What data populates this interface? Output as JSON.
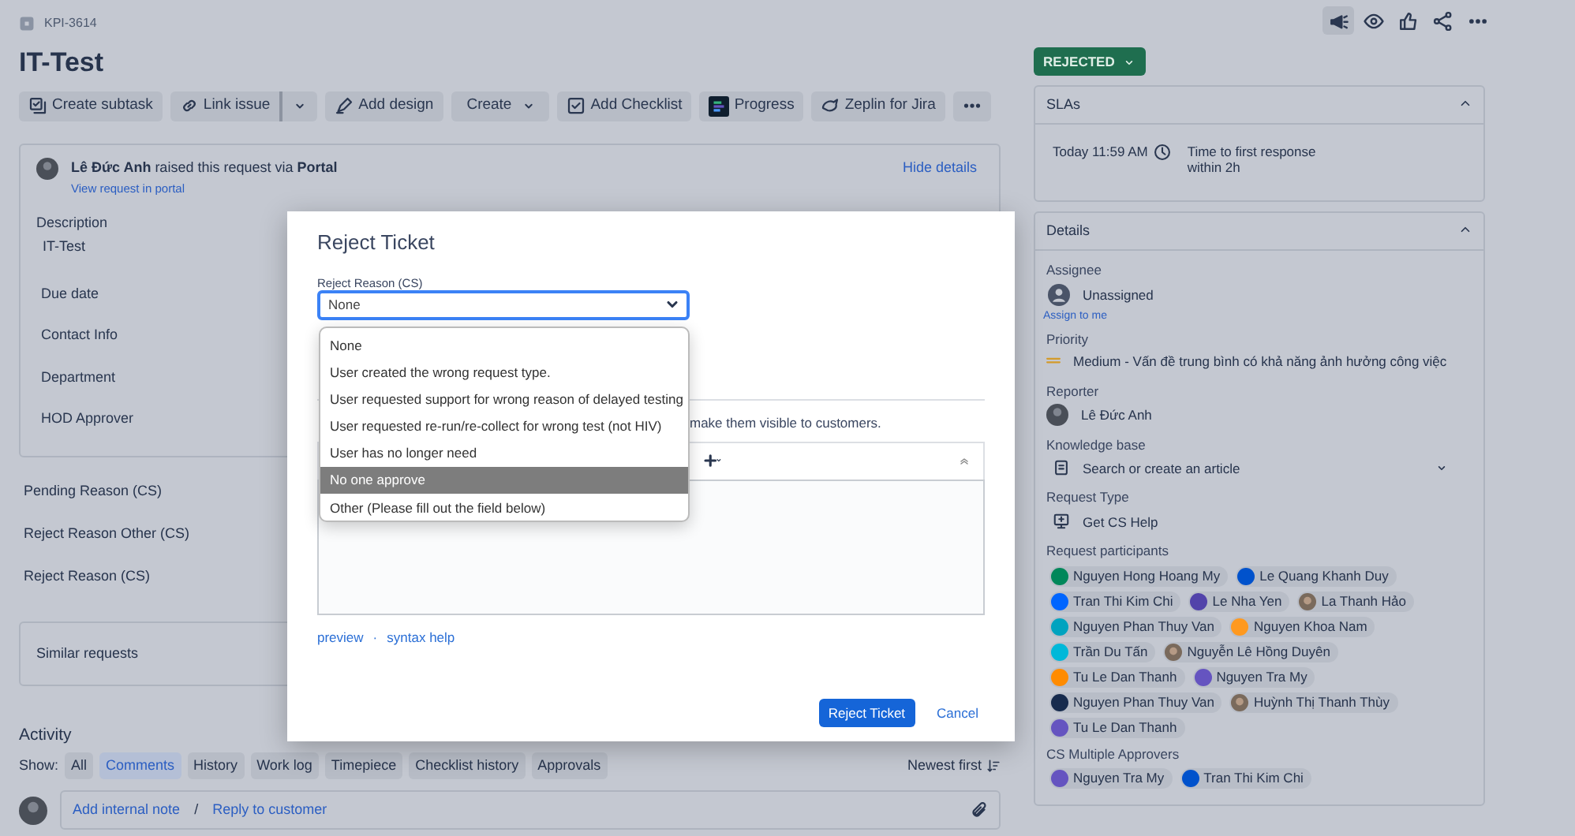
{
  "issue_key": "KPI-3614",
  "title": "IT-Test",
  "toolbar": [
    {
      "label": "Create subtask",
      "kind": "subtask"
    },
    {
      "label": "Link issue",
      "kind": "link"
    },
    {
      "label": "Add design",
      "kind": "design"
    },
    {
      "label": "Create",
      "kind": "menu"
    },
    {
      "label": "Add Checklist",
      "kind": "checklist"
    },
    {
      "label": "Progress",
      "kind": "progress"
    },
    {
      "label": "Zeplin for Jira",
      "kind": "zeplin"
    },
    {
      "kind": "more"
    }
  ],
  "request": {
    "sentence": "**Lê Đức Anh** raised this request via **Portal**",
    "view_link": "View request in portal",
    "hide_link": "Hide details",
    "fields": [
      {
        "label": "Description",
        "value": "IT-Test"
      },
      {
        "label": "Due date"
      },
      {
        "label": "Contact Info"
      },
      {
        "label": "Department"
      },
      {
        "label": "HOD Approver"
      }
    ]
  },
  "extra_fields": [
    "Pending Reason (CS)",
    "Reject Reason Other (CS)",
    "Reject Reason (CS)"
  ],
  "similar": "Similar requests",
  "activity": {
    "title": "Activity",
    "show_label": "Show:",
    "filters": [
      {
        "label": "All",
        "selected": false
      },
      {
        "label": "Comments",
        "selected": true
      },
      {
        "label": "History",
        "selected": false
      },
      {
        "label": "Work log",
        "selected": false
      },
      {
        "label": "Timepiece",
        "selected": false
      },
      {
        "label": "Checklist history",
        "selected": false
      },
      {
        "label": "Approvals",
        "selected": false
      }
    ],
    "sort": "Newest first",
    "internal_note": "Add internal note",
    "separator": "/",
    "reply": "Reply to customer"
  },
  "header_icons": [
    {
      "kind": "megaphone",
      "selected": true
    },
    {
      "kind": "eye",
      "selected": false
    },
    {
      "kind": "like",
      "selected": false
    },
    {
      "kind": "share",
      "selected": false
    },
    {
      "kind": "more",
      "selected": false
    }
  ],
  "status": "REJECTED",
  "slas": {
    "title": "SLAs",
    "time": "Today 11:59 AM",
    "goal": "Time to first response",
    "target": "within 2h"
  },
  "details": {
    "title": "Details",
    "assignee": {
      "label": "Assignee",
      "value": "Unassigned",
      "link": "Assign to me"
    },
    "priority": {
      "label": "Priority",
      "value": "Medium - Vấn đề trung bình có khả năng ảnh hưởng công việc"
    },
    "reporter": {
      "label": "Reporter",
      "value": "Lê Đức Anh"
    },
    "knowledge_base": {
      "label": "Knowledge base",
      "placeholder": "Search or create an article"
    },
    "request_type": {
      "label": "Request Type",
      "value": "Get CS Help"
    },
    "participants": {
      "label": "Request participants",
      "list": [
        {
          "name": "Nguyen Hong Hoang My",
          "kind": "initials",
          "color": "#00875a"
        },
        {
          "name": "Le Quang Khanh Duy",
          "kind": "initials",
          "color": "#0052cc"
        },
        {
          "name": "Tran Thi Kim Chi",
          "kind": "initials",
          "color": "#0065ff"
        },
        {
          "name": "Le Nha Yen",
          "kind": "initials",
          "color": "#5243aa"
        },
        {
          "name": "La Thanh Hảo",
          "kind": "photo"
        },
        {
          "name": "Nguyen Phan Thuy Van",
          "kind": "initials",
          "color": "#00a3bf"
        },
        {
          "name": "Nguyen Khoa Nam",
          "kind": "initials",
          "color": "#ff991f"
        },
        {
          "name": "Trần Du Tấn",
          "kind": "initials",
          "color": "#00b8d9"
        },
        {
          "name": "Nguyễn Lê Hồng Duyên",
          "kind": "photo"
        },
        {
          "name": "Tu Le Dan Thanh",
          "kind": "initials",
          "color": "#ff8b00"
        },
        {
          "name": "Nguyen Tra My",
          "kind": "initials",
          "color": "#6554c0"
        },
        {
          "name": "Nguyen Phan Thuy Van",
          "kind": "initials",
          "color": "#172b4d"
        },
        {
          "name": "Huỳnh Thị Thanh Thùy",
          "kind": "photo"
        },
        {
          "name": "Tu Le Dan Thanh",
          "kind": "initials",
          "color": "#6554c0"
        }
      ]
    },
    "approvers": {
      "label": "CS Multiple Approvers",
      "list": [
        {
          "name": "Nguyen Tra My",
          "kind": "initials",
          "color": "#6554c0"
        },
        {
          "name": "Tran Thi Kim Chi",
          "kind": "initials",
          "color": "#0052cc"
        }
      ]
    }
  },
  "modal": {
    "title": "Reject Ticket",
    "field_label": "Reject Reason (CS)",
    "value": "None",
    "options": [
      {
        "label": "None",
        "highlighted": false
      },
      {
        "label": "User created the wrong request type.",
        "highlighted": false
      },
      {
        "label": "User requested support for wrong reason of delayed testing",
        "highlighted": false
      },
      {
        "label": "User requested re-run/re-collect for wrong test (not HIV)",
        "highlighted": false
      },
      {
        "label": "User has no longer need",
        "highlighted": false
      },
      {
        "label": "No one approve",
        "highlighted": true
      },
      {
        "label": "Other (Please fill out the field below)",
        "highlighted": false
      }
    ],
    "hint": "make them visible to customers.",
    "preview": "preview",
    "dot": "·",
    "syntax_help": "syntax help",
    "submit": "Reject Ticket",
    "cancel": "Cancel"
  }
}
